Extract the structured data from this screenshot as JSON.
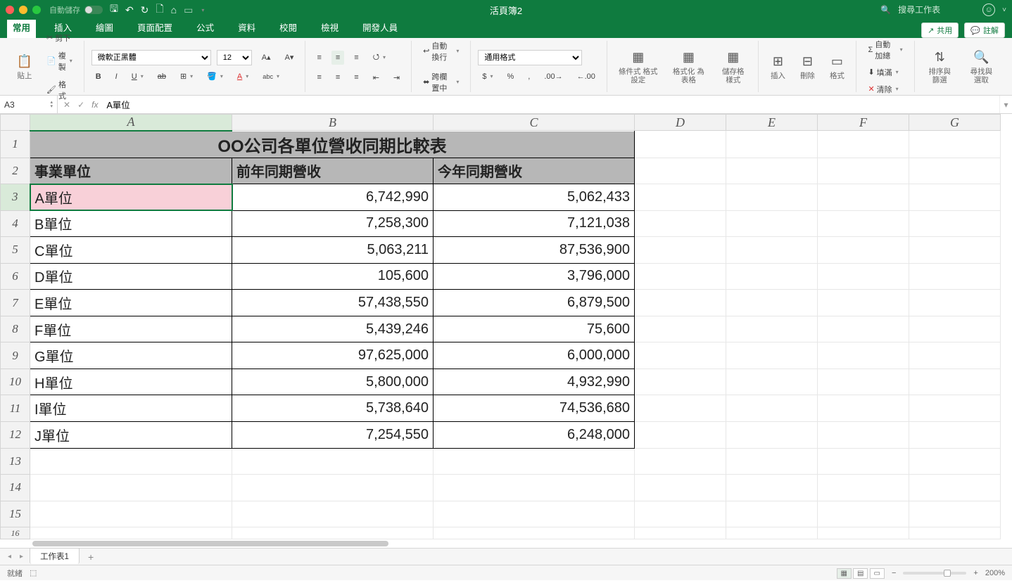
{
  "window": {
    "autosave_label": "自動儲存",
    "toggle_state": "關閉",
    "doc_title": "活頁簿2",
    "search_placeholder": "搜尋工作表"
  },
  "menu": {
    "tabs": [
      "常用",
      "插入",
      "繪圖",
      "頁面配置",
      "公式",
      "資料",
      "校閱",
      "檢視",
      "開發人員"
    ],
    "active": 0,
    "share": "共用",
    "comments": "註解"
  },
  "ribbon": {
    "paste": "貼上",
    "cut": "剪下",
    "copy": "複製",
    "format_painter": "格式",
    "font_name": "微軟正黑體",
    "font_size": "12",
    "wrap_text": "自動換行",
    "merge_center": "跨欄置中",
    "number_format": "通用格式",
    "cond_fmt": "條件式\n格式設定",
    "fmt_table": "格式化\n為表格",
    "cell_styles": "儲存格\n樣式",
    "insert": "插入",
    "delete": "刪除",
    "format": "格式",
    "autosum": "自動加總",
    "fill": "填滿",
    "clear": "清除",
    "sort_filter": "排序與\n篩選",
    "find_select": "尋找與\n選取"
  },
  "fx": {
    "name_box": "A3",
    "formula": "A單位"
  },
  "columns": [
    "A",
    "B",
    "C",
    "D",
    "E",
    "F",
    "G"
  ],
  "row_count": 16,
  "sheet": {
    "title": "OO公司各單位營收同期比較表",
    "headers": [
      "事業單位",
      "前年同期營收",
      "今年同期營收"
    ],
    "rows": [
      {
        "unit": "A單位",
        "prev": "6,742,990",
        "curr": "5,062,433",
        "hl": true
      },
      {
        "unit": "B單位",
        "prev": "7,258,300",
        "curr": "7,121,038"
      },
      {
        "unit": "C單位",
        "prev": "5,063,211",
        "curr": "87,536,900"
      },
      {
        "unit": "D單位",
        "prev": "105,600",
        "curr": "3,796,000"
      },
      {
        "unit": "E單位",
        "prev": "57,438,550",
        "curr": "6,879,500"
      },
      {
        "unit": "F單位",
        "prev": "5,439,246",
        "curr": "75,600"
      },
      {
        "unit": "G單位",
        "prev": "97,625,000",
        "curr": "6,000,000"
      },
      {
        "unit": "H單位",
        "prev": "5,800,000",
        "curr": "4,932,990"
      },
      {
        "unit": "I單位",
        "prev": "5,738,640",
        "curr": "74,536,680"
      },
      {
        "unit": "J單位",
        "prev": "7,254,550",
        "curr": "6,248,000"
      }
    ]
  },
  "tabs": {
    "sheet1": "工作表1"
  },
  "status": {
    "ready": "就緒",
    "zoom": "200%"
  },
  "selected": {
    "row": 3,
    "col": "A"
  }
}
